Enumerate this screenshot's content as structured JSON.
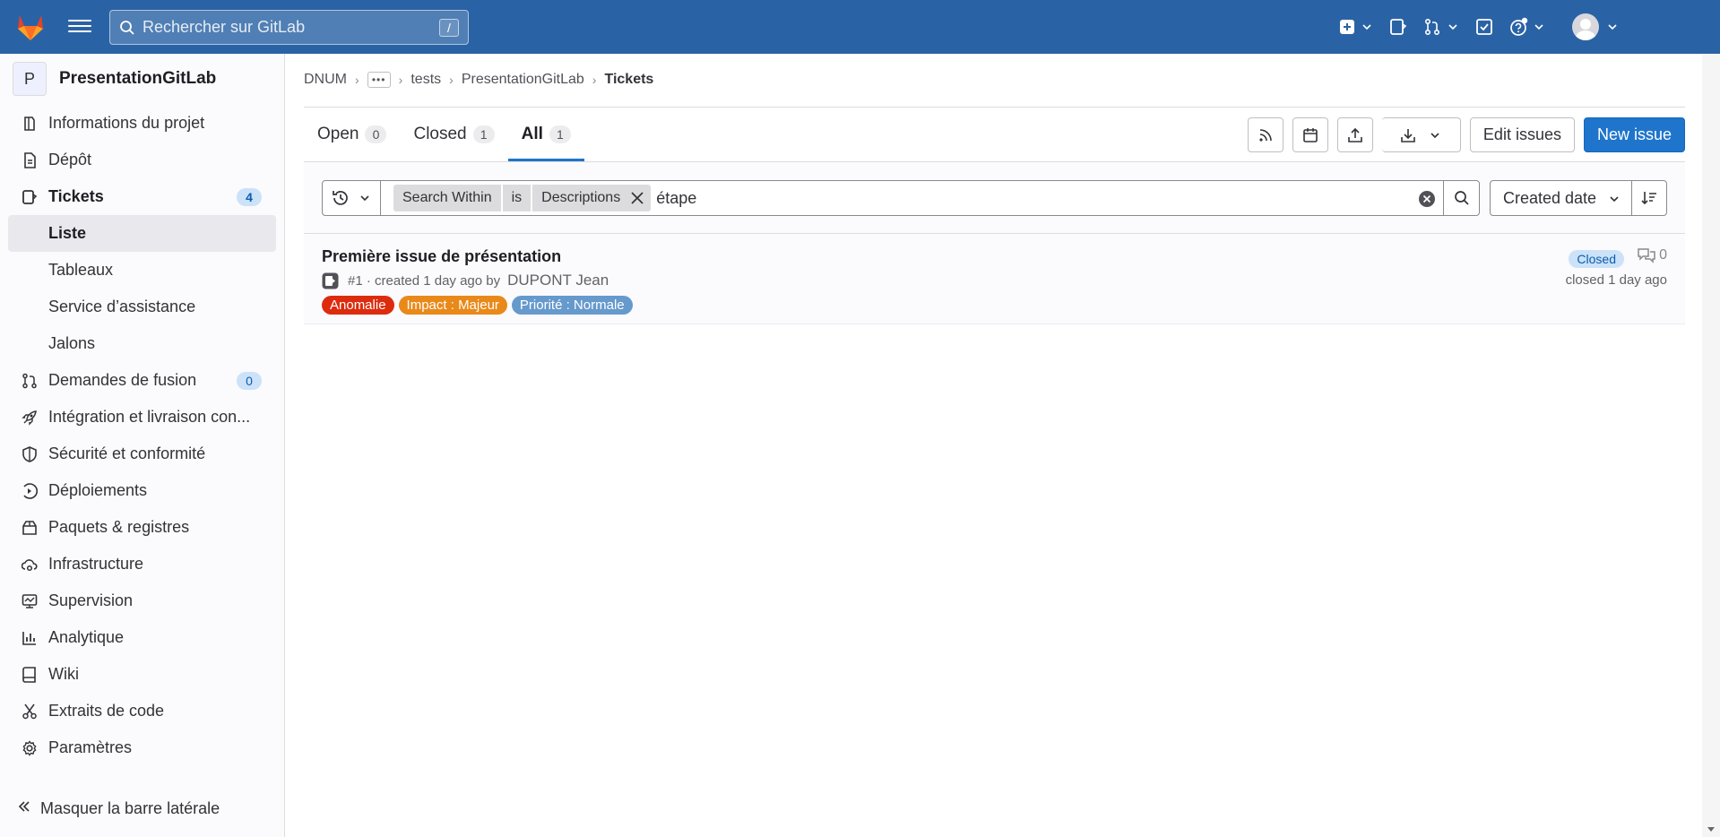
{
  "topbar": {
    "search_placeholder": "Rechercher sur GitLab",
    "search_shortcut": "/",
    "brand_color": "#2a63a5"
  },
  "sidebar": {
    "project_initial": "P",
    "project_name": "PresentationGitLab",
    "items": [
      {
        "label": "Informations du projet",
        "icon": "project-icon"
      },
      {
        "label": "Dépôt",
        "icon": "doc-icon"
      },
      {
        "label": "Tickets",
        "icon": "issues-icon",
        "count": "4"
      },
      {
        "label": "Liste"
      },
      {
        "label": "Tableaux"
      },
      {
        "label": "Service d’assistance"
      },
      {
        "label": "Jalons"
      },
      {
        "label": "Demandes de fusion",
        "icon": "merge-request-icon",
        "count": "0"
      },
      {
        "label": "Intégration et livraison con...",
        "icon": "rocket-icon"
      },
      {
        "label": "Sécurité et conformité",
        "icon": "shield-icon"
      },
      {
        "label": "Déploiements",
        "icon": "deployments-icon"
      },
      {
        "label": "Paquets & registres",
        "icon": "package-icon"
      },
      {
        "label": "Infrastructure",
        "icon": "cloud-gear-icon"
      },
      {
        "label": "Supervision",
        "icon": "monitor-icon"
      },
      {
        "label": "Analytique",
        "icon": "chart-icon"
      },
      {
        "label": "Wiki",
        "icon": "book-icon"
      },
      {
        "label": "Extraits de code",
        "icon": "scissors-icon"
      },
      {
        "label": "Paramètres",
        "icon": "gear-icon"
      }
    ],
    "collapse_label": "Masquer la barre latérale"
  },
  "breadcrumb": {
    "items": [
      "DNUM",
      "tests",
      "PresentationGitLab",
      "Tickets"
    ],
    "ellipsis": "•••"
  },
  "tabs": [
    {
      "label": "Open",
      "count": "0"
    },
    {
      "label": "Closed",
      "count": "1"
    },
    {
      "label": "All",
      "count": "1"
    }
  ],
  "actions": {
    "edit_label": "Edit issues",
    "new_label": "New issue"
  },
  "filter": {
    "token_name": "Search Within",
    "token_operator": "is",
    "token_value": "Descriptions",
    "typed_text": "étape",
    "sort_label": "Created date"
  },
  "issue": {
    "title": "Première issue de présentation",
    "meta": "#1 · created 1 day ago by",
    "author": "DUPONT Jean",
    "status": "Closed",
    "comments": "0",
    "closed_time": "closed 1 day ago",
    "labels": [
      {
        "text": "Anomalie",
        "color": "#dd2b0e"
      },
      {
        "text": "Impact : Majeur",
        "color": "#e9891a"
      },
      {
        "text": "Priorité : Normale",
        "color": "#6699cc"
      }
    ]
  }
}
